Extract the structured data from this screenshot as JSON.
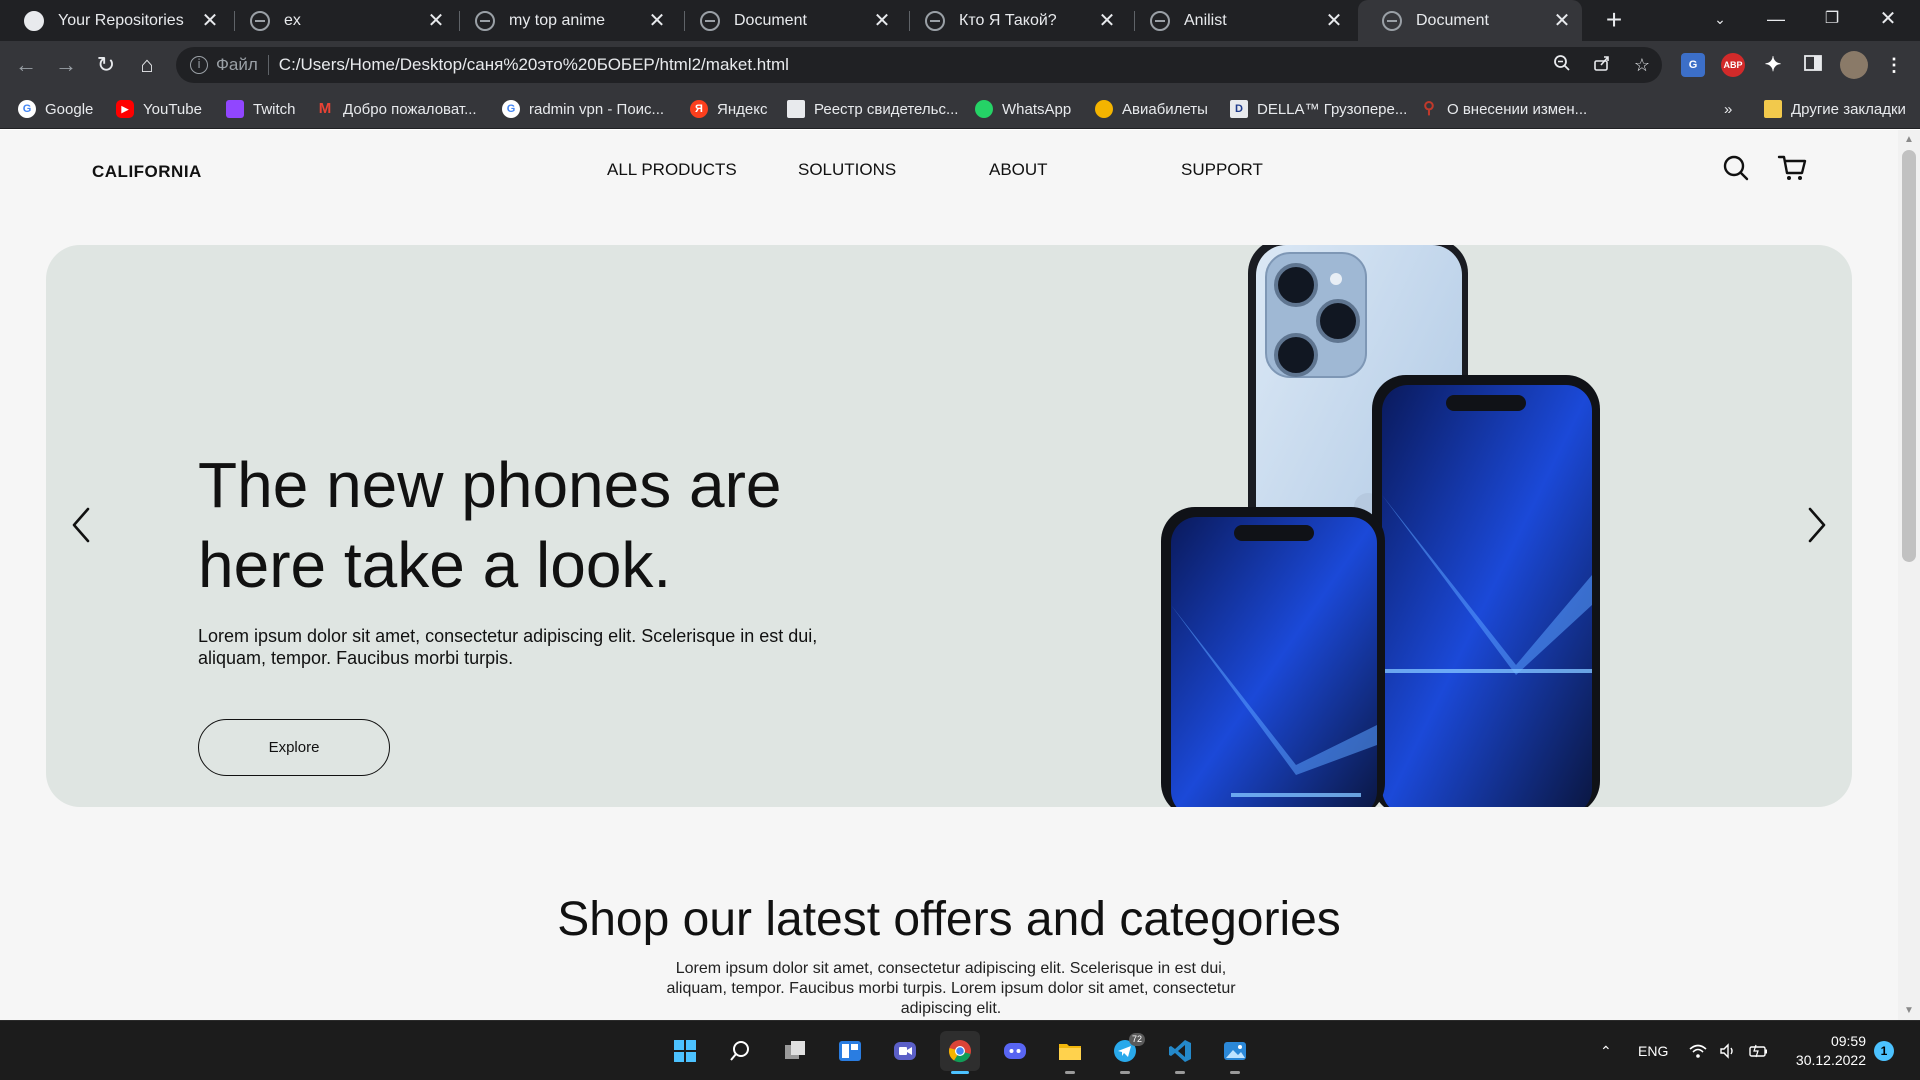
{
  "browser": {
    "tabs": [
      {
        "title": "Your Repositories"
      },
      {
        "title": "ex"
      },
      {
        "title": "my top anime"
      },
      {
        "title": "Document"
      },
      {
        "title": "Кто Я Такой?"
      },
      {
        "title": "Anilist"
      },
      {
        "title": "Document",
        "active": true
      }
    ],
    "tab_close_glyph": "✕",
    "new_tab_glyph": "+",
    "address": {
      "scheme_label": "Файл",
      "url": "C:/Users/Home/Desktop/саня%20это%20БОБЕР/html2/maket.html"
    },
    "extensions": {
      "abp_label": "ABP"
    },
    "bookmarks": [
      {
        "label": "Google",
        "icon": "google-icon"
      },
      {
        "label": "YouTube",
        "icon": "youtube-icon"
      },
      {
        "label": "Twitch",
        "icon": "twitch-icon"
      },
      {
        "label": "Добро пожаловат...",
        "icon": "gmail-icon"
      },
      {
        "label": "radmin vpn - Поис...",
        "icon": "google-icon"
      },
      {
        "label": "Яндекс",
        "icon": "yandex-icon"
      },
      {
        "label": "Реестр свидетельс...",
        "icon": "registry-icon"
      },
      {
        "label": "WhatsApp",
        "icon": "whatsapp-icon"
      },
      {
        "label": "Авиабилеты",
        "icon": "aviasales-icon"
      },
      {
        "label": "DELLA™ Грузопере...",
        "icon": "della-icon"
      },
      {
        "label": "О внесении измен...",
        "icon": "search-icon"
      }
    ],
    "bookmarks_overflow": "»",
    "other_bookmarks": "Другие закладки"
  },
  "site": {
    "brand": "CALIFORNIA",
    "nav": [
      "ALL PRODUCTS",
      "SOLUTIONS",
      "ABOUT",
      "SUPPORT"
    ],
    "hero": {
      "title": "The new phones are here take a look.",
      "text": "Lorem ipsum dolor sit amet, consectetur adipiscing elit. Scelerisque in est dui, aliquam, tempor. Faucibus morbi turpis.",
      "button": "Explore"
    },
    "section": {
      "title": "Shop our latest offers and categories",
      "text": "Lorem ipsum dolor sit amet, consectetur adipiscing elit. Scelerisque in est dui, aliquam, tempor. Faucibus morbi turpis. Lorem ipsum dolor sit amet, consectetur adipiscing elit."
    }
  },
  "taskbar": {
    "apps": [
      "start-icon",
      "search-icon",
      "task-view-icon",
      "widgets-icon",
      "teams-chat-icon",
      "chrome-icon",
      "discord-icon",
      "file-explorer-icon",
      "telegram-icon",
      "vscode-icon",
      "photos-icon"
    ],
    "telegram_badge": "72",
    "language": "ENG",
    "time": "09:59",
    "date": "30.12.2022",
    "notifications": "1"
  },
  "colors": {
    "hero_bg": "#dfe5e2",
    "page_bg": "#f6f6f6",
    "chrome_dark": "#202124",
    "chrome_toolbar": "#35363a",
    "taskbar_accent": "#4cc2ff"
  }
}
